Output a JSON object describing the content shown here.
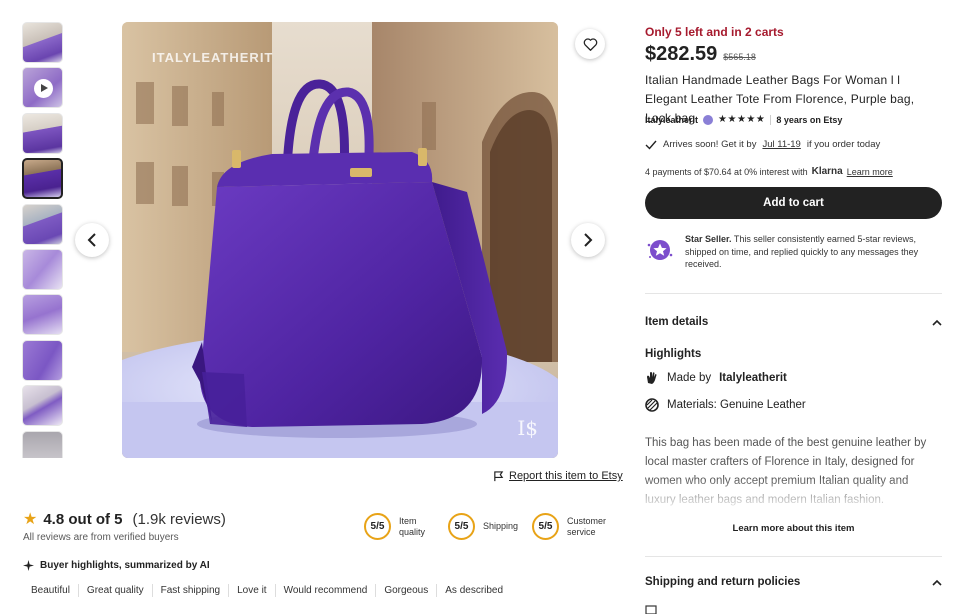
{
  "thumbnails": [
    {
      "name": "thumb-1"
    },
    {
      "name": "thumb-video"
    },
    {
      "name": "thumb-3"
    },
    {
      "name": "thumb-4"
    },
    {
      "name": "thumb-5"
    },
    {
      "name": "thumb-6"
    },
    {
      "name": "thumb-7"
    },
    {
      "name": "thumb-8"
    },
    {
      "name": "thumb-9"
    },
    {
      "name": "thumb-10"
    }
  ],
  "main_image": {
    "watermark": "ITALYLEATHERIT",
    "monogram": "I$"
  },
  "report_link": "Report this item to Etsy",
  "reviews": {
    "score": "4.8 out of 5",
    "count": "(1.9k reviews)",
    "verified": "All reviews are from verified buyers",
    "metrics": [
      {
        "value": "5/5",
        "label_line1": "Item",
        "label_line2": "quality"
      },
      {
        "value": "5/5",
        "label_line1": "Shipping",
        "label_line2": ""
      },
      {
        "value": "5/5",
        "label_line1": "Customer",
        "label_line2": "service"
      }
    ],
    "ai_title": "Buyer highlights, summarized by AI",
    "tags": [
      "Beautiful",
      "Great quality",
      "Fast shipping",
      "Love it",
      "Would recommend",
      "Gorgeous",
      "As described"
    ]
  },
  "listing": {
    "stock": "Only 5 left and in 2 carts",
    "price": "$282.59",
    "original_price": "$565.18",
    "title": "Italian Handmade Leather Bags For Woman l l Elegant Leather Tote From Florence, Purple bag, Lock bag",
    "shop_name": "Italyleatherit",
    "stars": "★★★★★",
    "years": "8 years on Etsy",
    "arrive_prefix": "Arrives soon! Get it by",
    "arrive_date": "Jul 11-19",
    "arrive_suffix": "if you order today",
    "payments": "4 payments of $70.64 at 0% interest with",
    "klarna": "Klarna",
    "learn_more": "Learn more",
    "add_to_cart": "Add to cart",
    "star_seller_title": "Star Seller.",
    "star_seller_text": "This seller consistently earned 5-star reviews, shipped on time, and replied quickly to any messages they received."
  },
  "details": {
    "item_details": "Item details",
    "highlights": "Highlights",
    "made_by_prefix": "Made by",
    "made_by": "Italyleatherit",
    "materials": "Materials: Genuine Leather",
    "description": "This bag has been made of the best genuine leather by local master crafters of Florence in Italy, designed for women who only accept premium Italian quality and luxury leather bags and modern Italian fashion.",
    "learn_more_item": "Learn more about this item",
    "shipping_policies": "Shipping and return policies"
  },
  "colors": {
    "stock_red": "#a61a2e",
    "star_gold": "#e8a317",
    "dark": "#222222",
    "star_seller_purple": "#7c4dcc"
  }
}
